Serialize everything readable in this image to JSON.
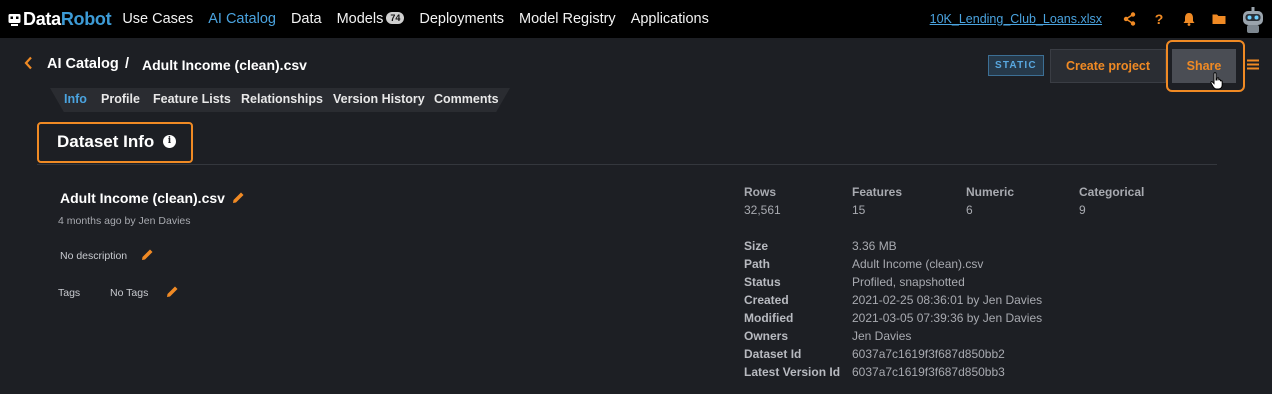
{
  "app": {
    "logo_part1": "Data",
    "logo_part2": "Robot"
  },
  "nav": {
    "items": [
      {
        "label": "Use Cases"
      },
      {
        "label": "AI Catalog"
      },
      {
        "label": "Data"
      },
      {
        "label": "Models",
        "badge": "74"
      },
      {
        "label": "Deployments"
      },
      {
        "label": "Model Registry"
      },
      {
        "label": "Applications"
      }
    ],
    "project_link": "10K_Lending_Club_Loans.xlsx",
    "icons": [
      "share-icon",
      "help-icon",
      "notification-bell-icon",
      "folder-icon",
      "robot-avatar"
    ],
    "help_glyph": "?",
    "accent": "#f08a24",
    "active_color": "#4aa3df"
  },
  "header": {
    "breadcrumb_root": "AI Catalog",
    "breadcrumb_sep": "/",
    "breadcrumb_current": "Adult Income (clean).csv",
    "static_badge": "STATIC",
    "create_project_label": "Create project",
    "share_label": "Share"
  },
  "tabs": [
    {
      "label": "Info"
    },
    {
      "label": "Profile"
    },
    {
      "label": "Feature Lists"
    },
    {
      "label": "Relationships"
    },
    {
      "label": "Version History"
    },
    {
      "label": "Comments"
    }
  ],
  "section": {
    "title": "Dataset Info",
    "info_glyph": "i"
  },
  "dataset": {
    "name": "Adult Income (clean).csv",
    "meta": "4 months ago by Jen Davies",
    "description": "No description",
    "tags_label": "Tags",
    "tags_value": "No Tags"
  },
  "stats": [
    {
      "label": "Rows",
      "value": "32,561"
    },
    {
      "label": "Features",
      "value": "15"
    },
    {
      "label": "Numeric",
      "value": "6"
    },
    {
      "label": "Categorical",
      "value": "9"
    }
  ],
  "properties": [
    {
      "label": "Size",
      "value": "3.36 MB"
    },
    {
      "label": "Path",
      "value": "Adult Income (clean).csv"
    },
    {
      "label": "Status",
      "value": "Profiled, snapshotted"
    },
    {
      "label": "Created",
      "value": "2021-02-25 08:36:01 by Jen Davies"
    },
    {
      "label": "Modified",
      "value": "2021-03-05 07:39:36 by Jen Davies"
    },
    {
      "label": "Owners",
      "value": "Jen Davies"
    },
    {
      "label": "Dataset Id",
      "value": "6037a7c1619f3f687d850bb2"
    },
    {
      "label": "Latest Version Id",
      "value": "6037a7c1619f3f687d850bb3"
    }
  ]
}
